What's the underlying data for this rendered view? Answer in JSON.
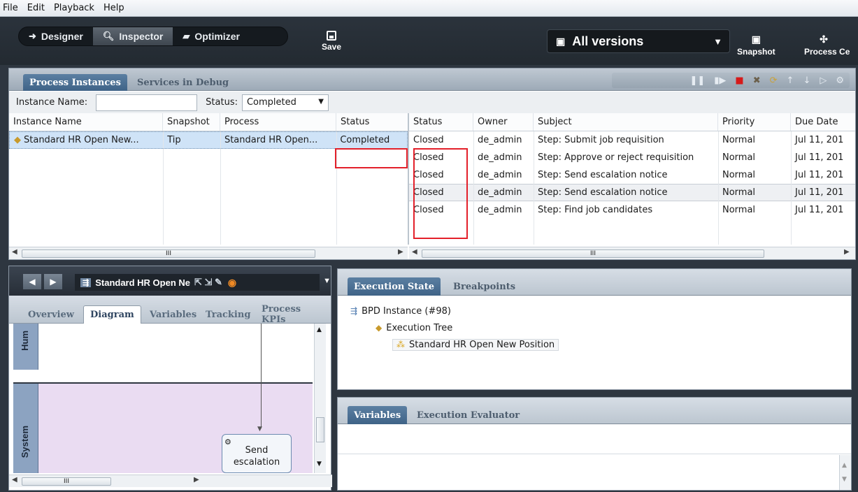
{
  "menu": [
    "File",
    "Edit",
    "Playback",
    "Help"
  ],
  "toolbar": {
    "designer": "Designer",
    "inspector": "Inspector",
    "optimizer": "Optimizer",
    "save": "Save",
    "versions": "All versions",
    "snapshot": "Snapshot",
    "process_center": "Process Ce"
  },
  "instances_panel": {
    "tab_active": "Process Instances",
    "tab_other": "Services in Debug",
    "filter_name_label": "Instance Name:",
    "filter_name_value": "",
    "filter_status_label": "Status:",
    "filter_status_value": "Completed",
    "left_columns": [
      "Instance Name",
      "Snapshot",
      "Process",
      "Status"
    ],
    "left_rows": [
      {
        "name": "Standard HR Open New...",
        "snapshot": "Tip",
        "process": "Standard HR Open...",
        "status": "Completed"
      }
    ],
    "right_columns": [
      "Status",
      "Owner",
      "Subject",
      "Priority",
      "Due Date"
    ],
    "right_rows": [
      {
        "status": "Closed",
        "owner": "de_admin",
        "subject": "Step: Submit job requisition",
        "priority": "Normal",
        "due": "Jul 11, 201"
      },
      {
        "status": "Closed",
        "owner": "de_admin",
        "subject": "Step: Approve or reject requisition",
        "priority": "Normal",
        "due": "Jul 11, 201"
      },
      {
        "status": "Closed",
        "owner": "de_admin",
        "subject": "Step: Send escalation notice",
        "priority": "Normal",
        "due": "Jul 11, 201"
      },
      {
        "status": "Closed",
        "owner": "de_admin",
        "subject": "Step: Send escalation notice",
        "priority": "Normal",
        "due": "Jul 11, 201"
      },
      {
        "status": "Closed",
        "owner": "de_admin",
        "subject": "Step: Find job candidates",
        "priority": "Normal",
        "due": "Jul 11, 201"
      }
    ],
    "scroll_mark": "III"
  },
  "diagram_panel": {
    "bpd_title": "Standard HR Open Ne",
    "tabs": [
      "Overview",
      "Diagram",
      "Variables",
      "Tracking",
      "Process KPIs"
    ],
    "lane_top": "Hum",
    "lane_bottom": "System",
    "activity_line1": "Send",
    "activity_line2": "escalation",
    "scroll_mark": "III"
  },
  "execution_panel": {
    "tab_active": "Execution State",
    "tab_other": "Breakpoints",
    "tree": [
      "BPD Instance (#98)",
      "Execution Tree",
      "Standard HR Open New Position"
    ]
  },
  "variables_panel": {
    "tab_active": "Variables",
    "tab_other": "Execution Evaluator"
  },
  "colors": {
    "highlight_box": "#e3202a",
    "selected_row": "#cfe3f7",
    "lane_fill": "#eadcf2"
  }
}
